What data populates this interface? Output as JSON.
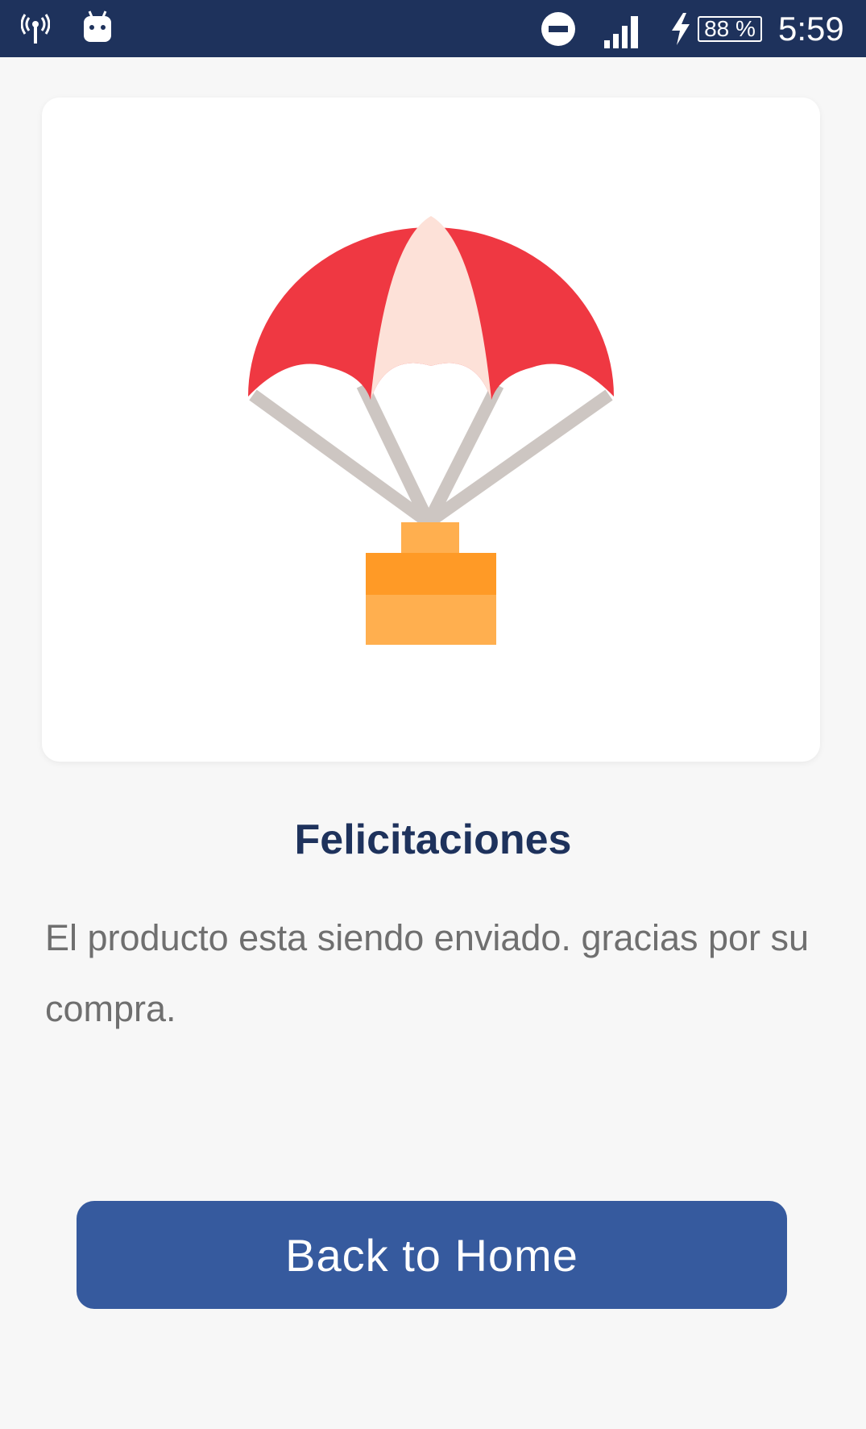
{
  "status_bar": {
    "battery": "88 %",
    "time": "5:59",
    "icons": [
      "wireless-signal-icon",
      "android-icon",
      "do-not-disturb-icon",
      "cell-signal-icon",
      "charging-icon",
      "battery-icon"
    ],
    "background": "#1e325c"
  },
  "illustration": {
    "icon": "parachute-box-icon",
    "colors": {
      "canopy": "#ef3842",
      "canopy_center": "#fde1d8",
      "lines": "#cdc6c2",
      "box_top": "#ffaf4f",
      "box_middle": "#ff9a26"
    }
  },
  "content": {
    "title": "Felicitaciones",
    "message": "El producto esta siendo enviado. gracias por su compra."
  },
  "actions": {
    "back_label": "Back to Home",
    "accent": "#365a9e"
  }
}
